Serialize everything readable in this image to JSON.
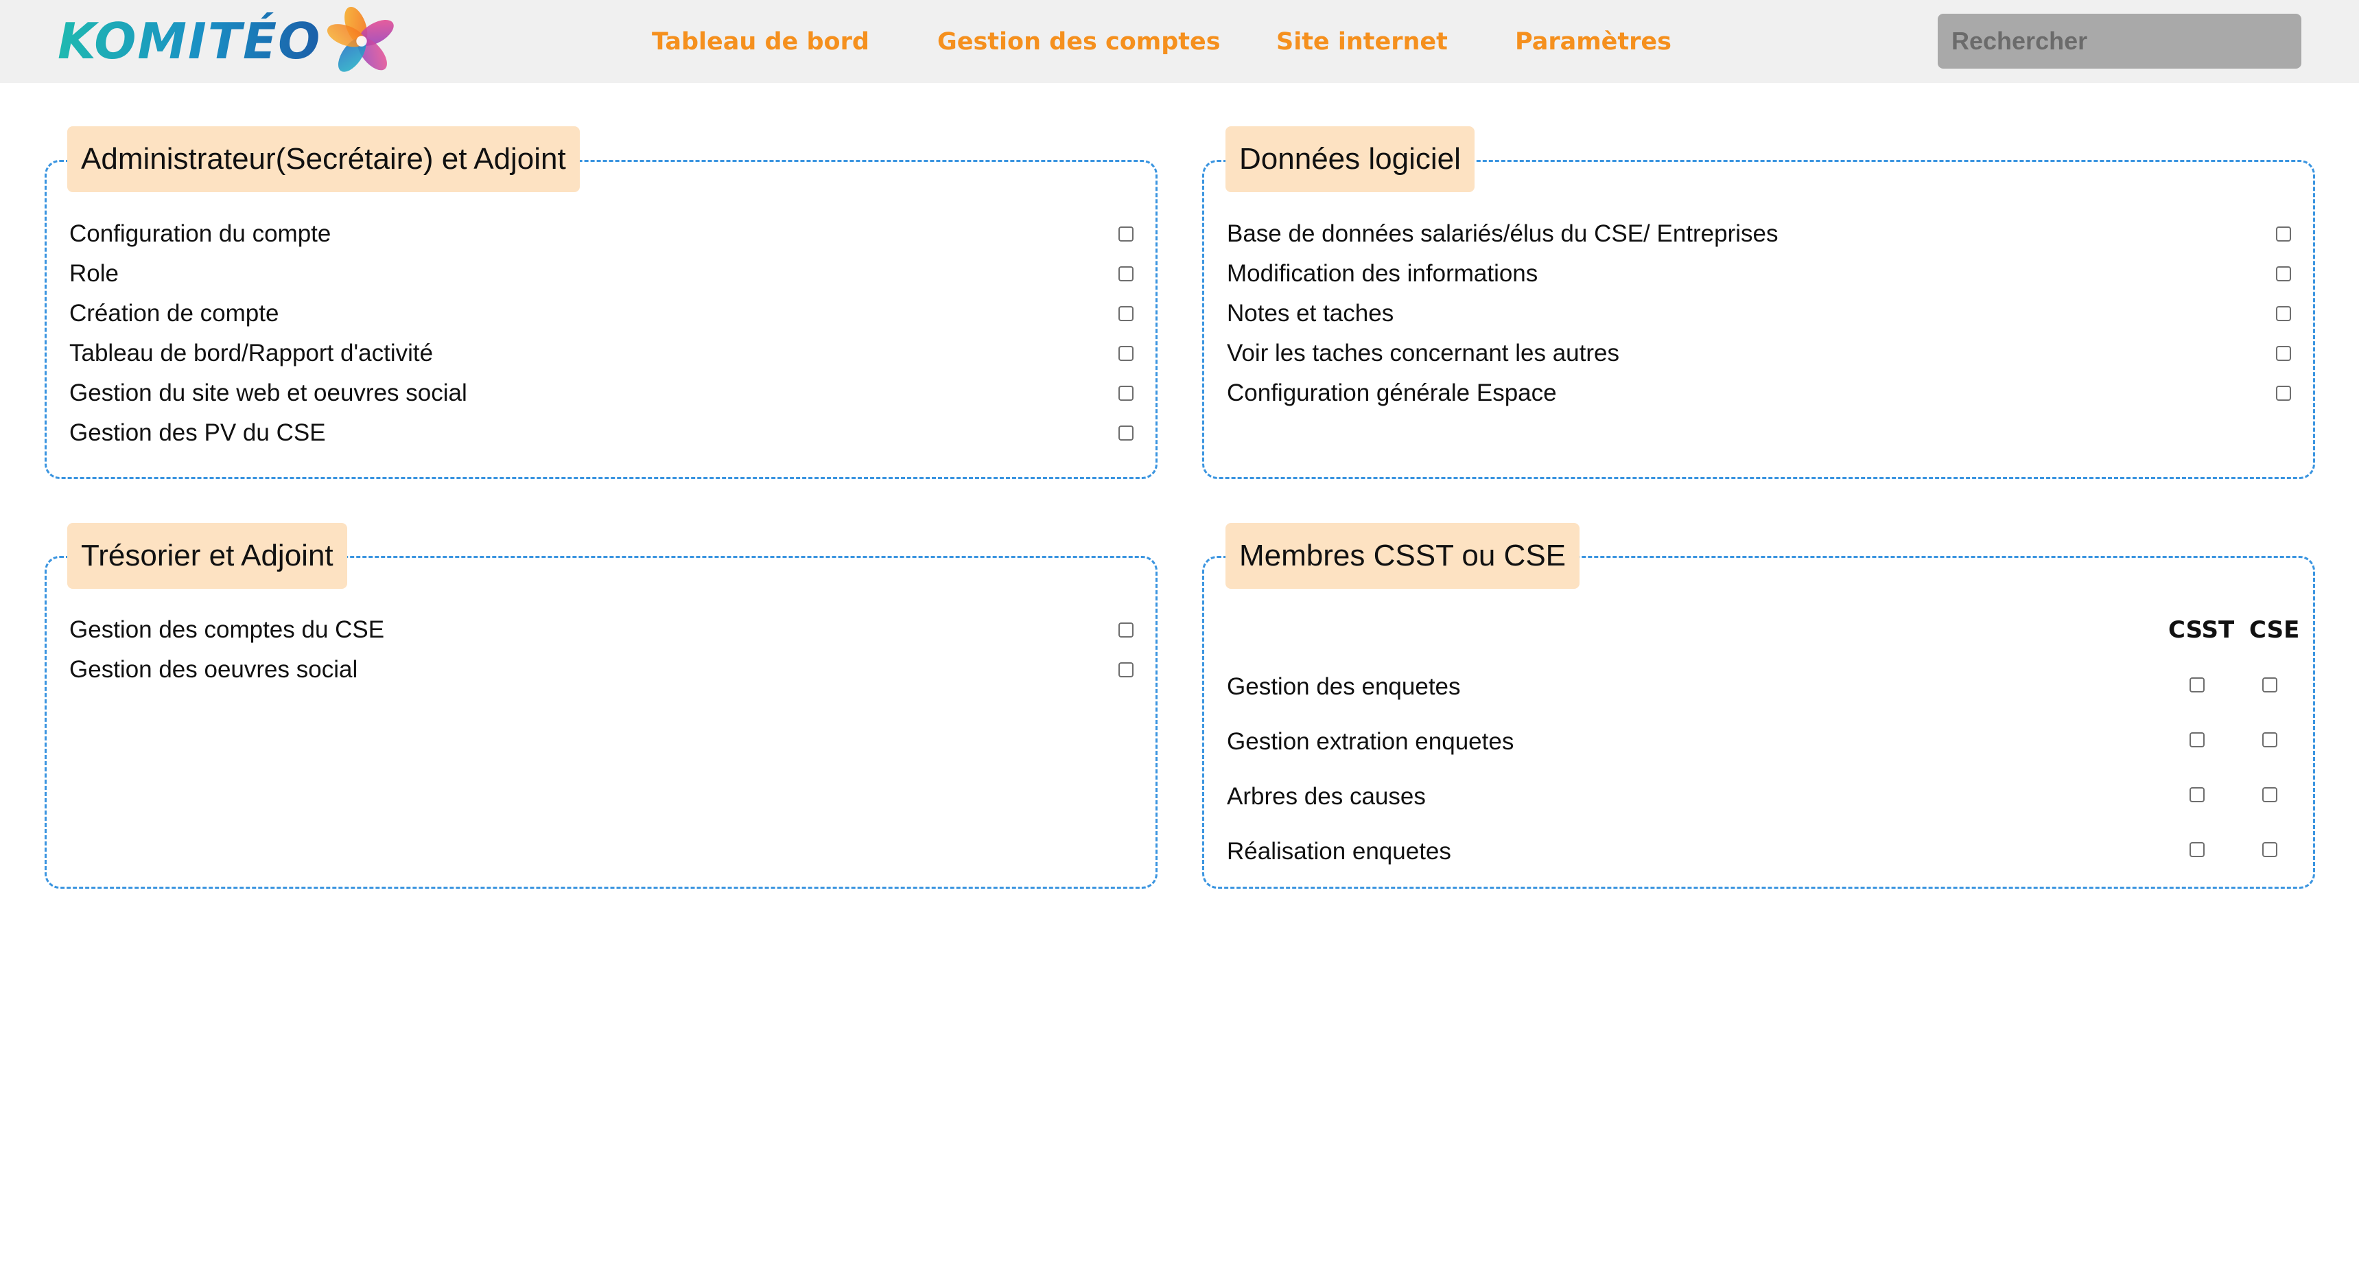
{
  "header": {
    "logo_text": "KOMITÉO",
    "logo_icon": "komiteo-flower-logo",
    "accent_color": "#f5901e",
    "nav": [
      {
        "label": "Tableau de bord"
      },
      {
        "label": "Gestion des comptes"
      },
      {
        "label": "Site internet"
      },
      {
        "label": "Paramètres"
      }
    ],
    "search": {
      "placeholder": "Rechercher",
      "value": ""
    }
  },
  "panels": {
    "admin": {
      "title": "Administrateur(Secrétaire) et Adjoint",
      "items": [
        {
          "label": "Configuration du compte",
          "checked": false
        },
        {
          "label": "Role",
          "checked": false
        },
        {
          "label": "Création de compte",
          "checked": false
        },
        {
          "label": "Tableau de bord/Rapport d'activité",
          "checked": false
        },
        {
          "label": "Gestion du site web et oeuvres social",
          "checked": false
        },
        {
          "label": "Gestion des PV du CSE",
          "checked": false
        }
      ]
    },
    "donnees": {
      "title": "Données logiciel",
      "items": [
        {
          "label": "Base de données salariés/élus du CSE/ Entreprises",
          "checked": false
        },
        {
          "label": "Modification des informations",
          "checked": false
        },
        {
          "label": "Notes et taches",
          "checked": false
        },
        {
          "label": "Voir les taches concernant les autres",
          "checked": false
        },
        {
          "label": "Configuration générale Espace",
          "checked": false
        }
      ]
    },
    "tresorier": {
      "title": "Trésorier et Adjoint",
      "items": [
        {
          "label": "Gestion des comptes du CSE",
          "checked": false
        },
        {
          "label": "Gestion des oeuvres social",
          "checked": false
        }
      ]
    },
    "membres": {
      "title": "Membres CSST ou CSE",
      "columns": [
        "CSST",
        "CSE"
      ],
      "items": [
        {
          "label": "Gestion des enquetes",
          "csst": false,
          "cse": false
        },
        {
          "label": "Gestion extration enquetes",
          "csst": false,
          "cse": false
        },
        {
          "label": "Arbres des causes",
          "csst": false,
          "cse": false
        },
        {
          "label": "Réalisation enquetes",
          "csst": false,
          "cse": false
        }
      ]
    }
  }
}
